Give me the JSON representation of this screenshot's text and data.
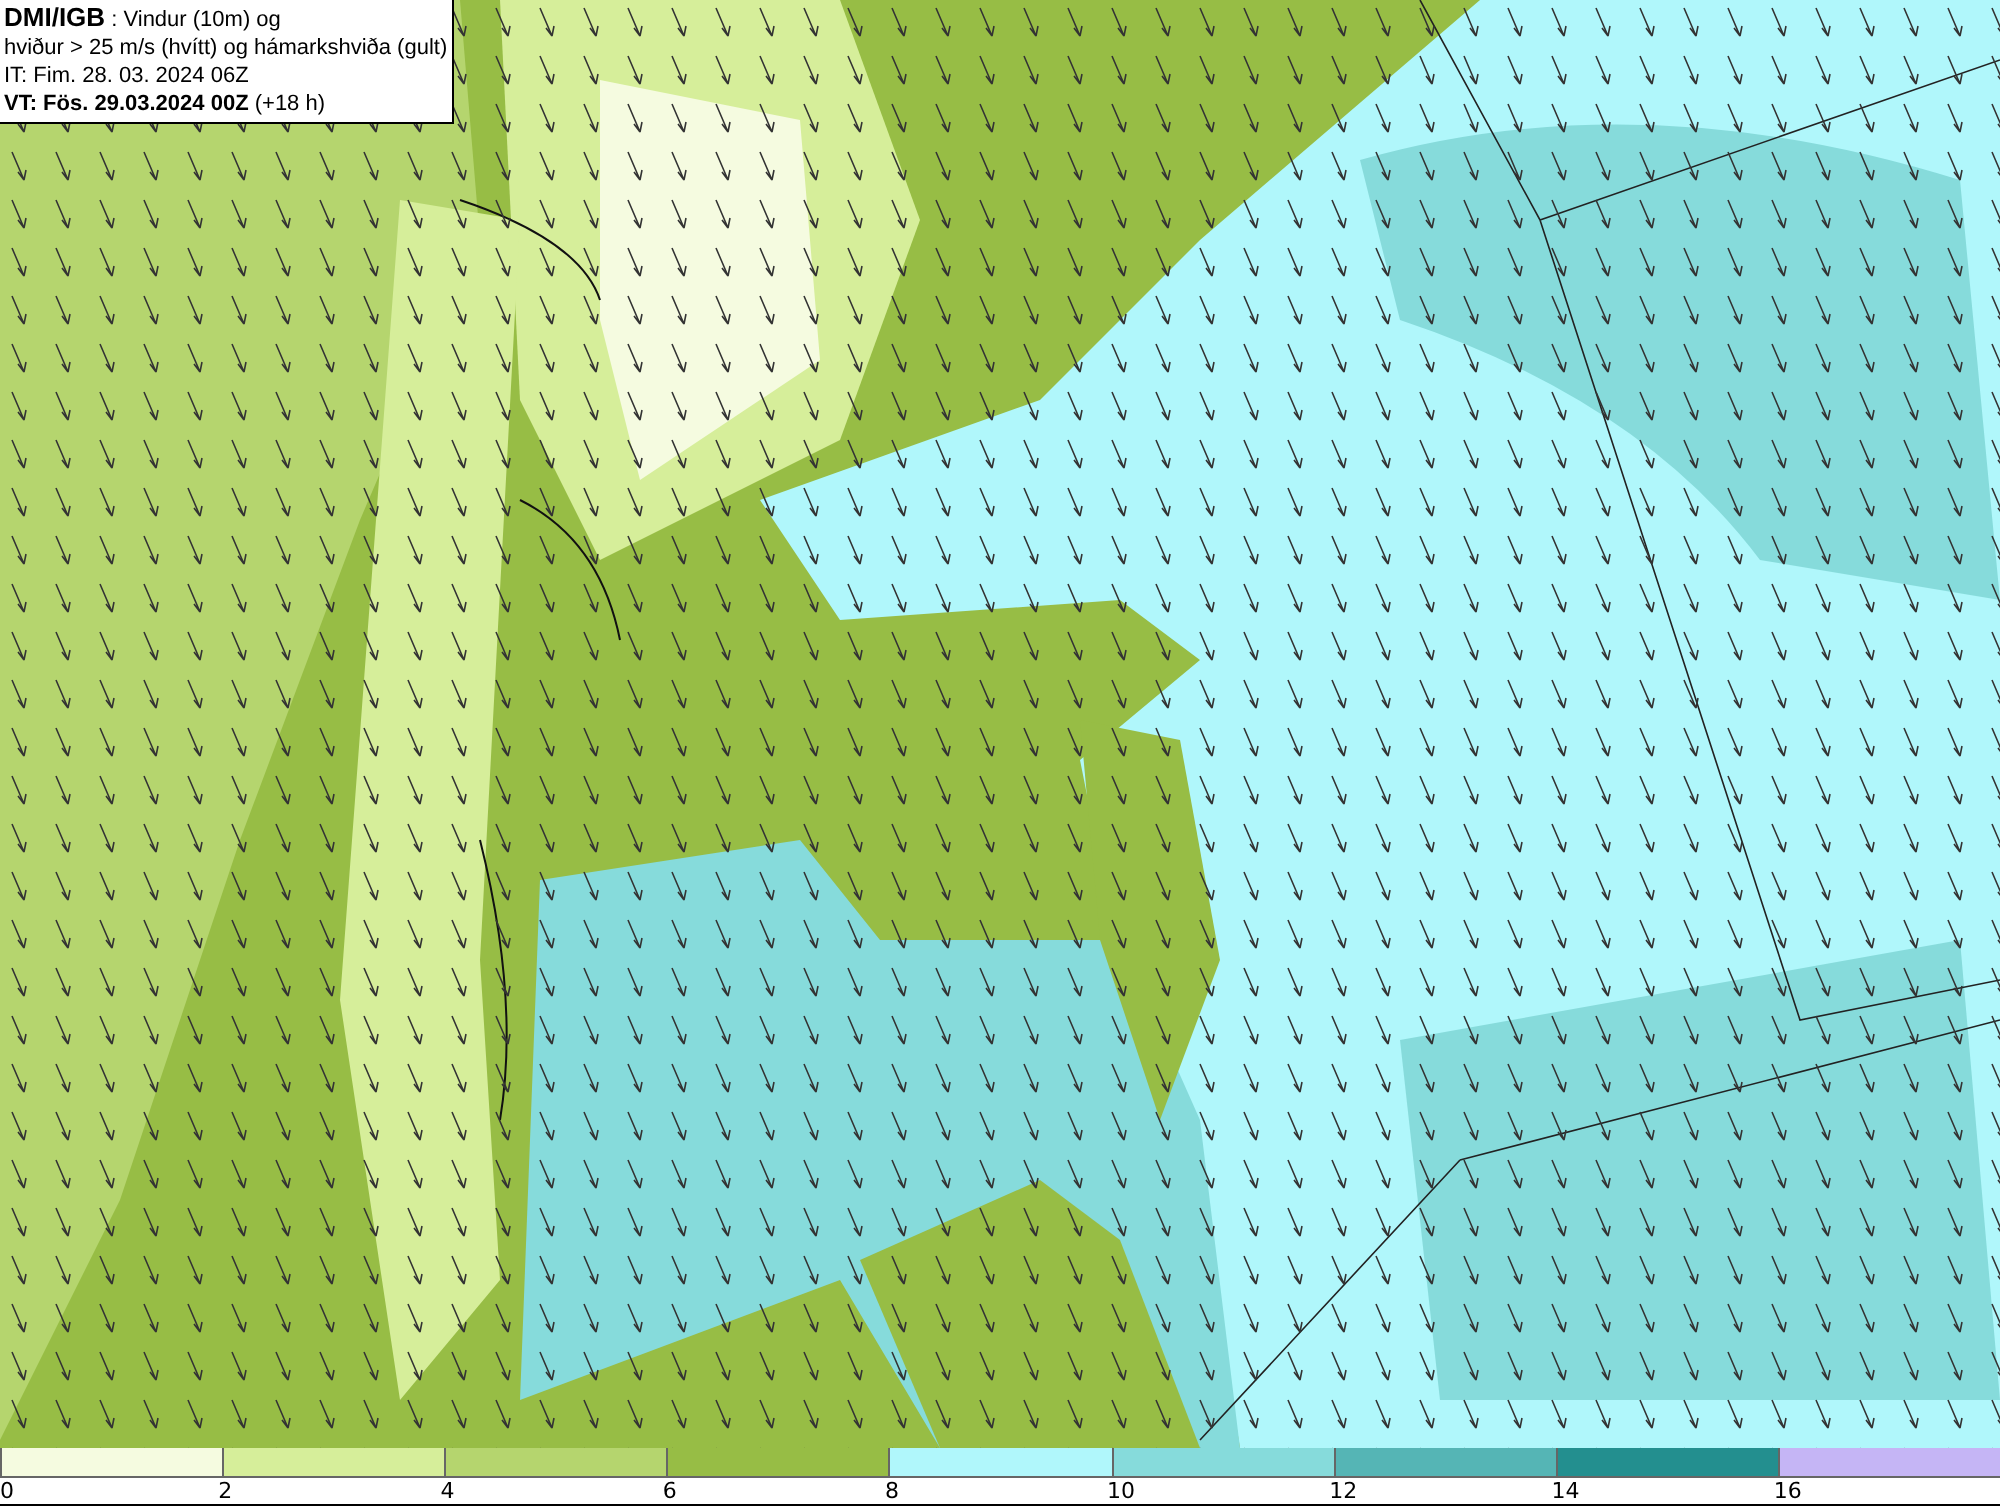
{
  "header": {
    "source": "DMI/IGB",
    "title": " : Vindur (10m) og",
    "subtitle": "hviður > 25 m/s (hvítt) og hámarkshviða (gult)",
    "issue_time": "IT: Fim. 28. 03. 2024 06Z",
    "valid_time_bold": "VT: Fös. 29.03.2024 00Z",
    "valid_offset": " (+18 h)"
  },
  "legend": {
    "segments": [
      {
        "color": "#f5fbe0",
        "label": "0"
      },
      {
        "color": "#d6ee9a",
        "label": "2"
      },
      {
        "color": "#b5d56e",
        "label": "4"
      },
      {
        "color": "#97bd45",
        "label": "6"
      },
      {
        "color": "#b0f7fb",
        "label": "8"
      },
      {
        "color": "#86dbdb",
        "label": "10"
      },
      {
        "color": "#55b5b5",
        "label": "12"
      },
      {
        "color": "#238f8f",
        "label": "14"
      },
      {
        "color": "#c5b5f5",
        "label": "16"
      }
    ]
  }
}
